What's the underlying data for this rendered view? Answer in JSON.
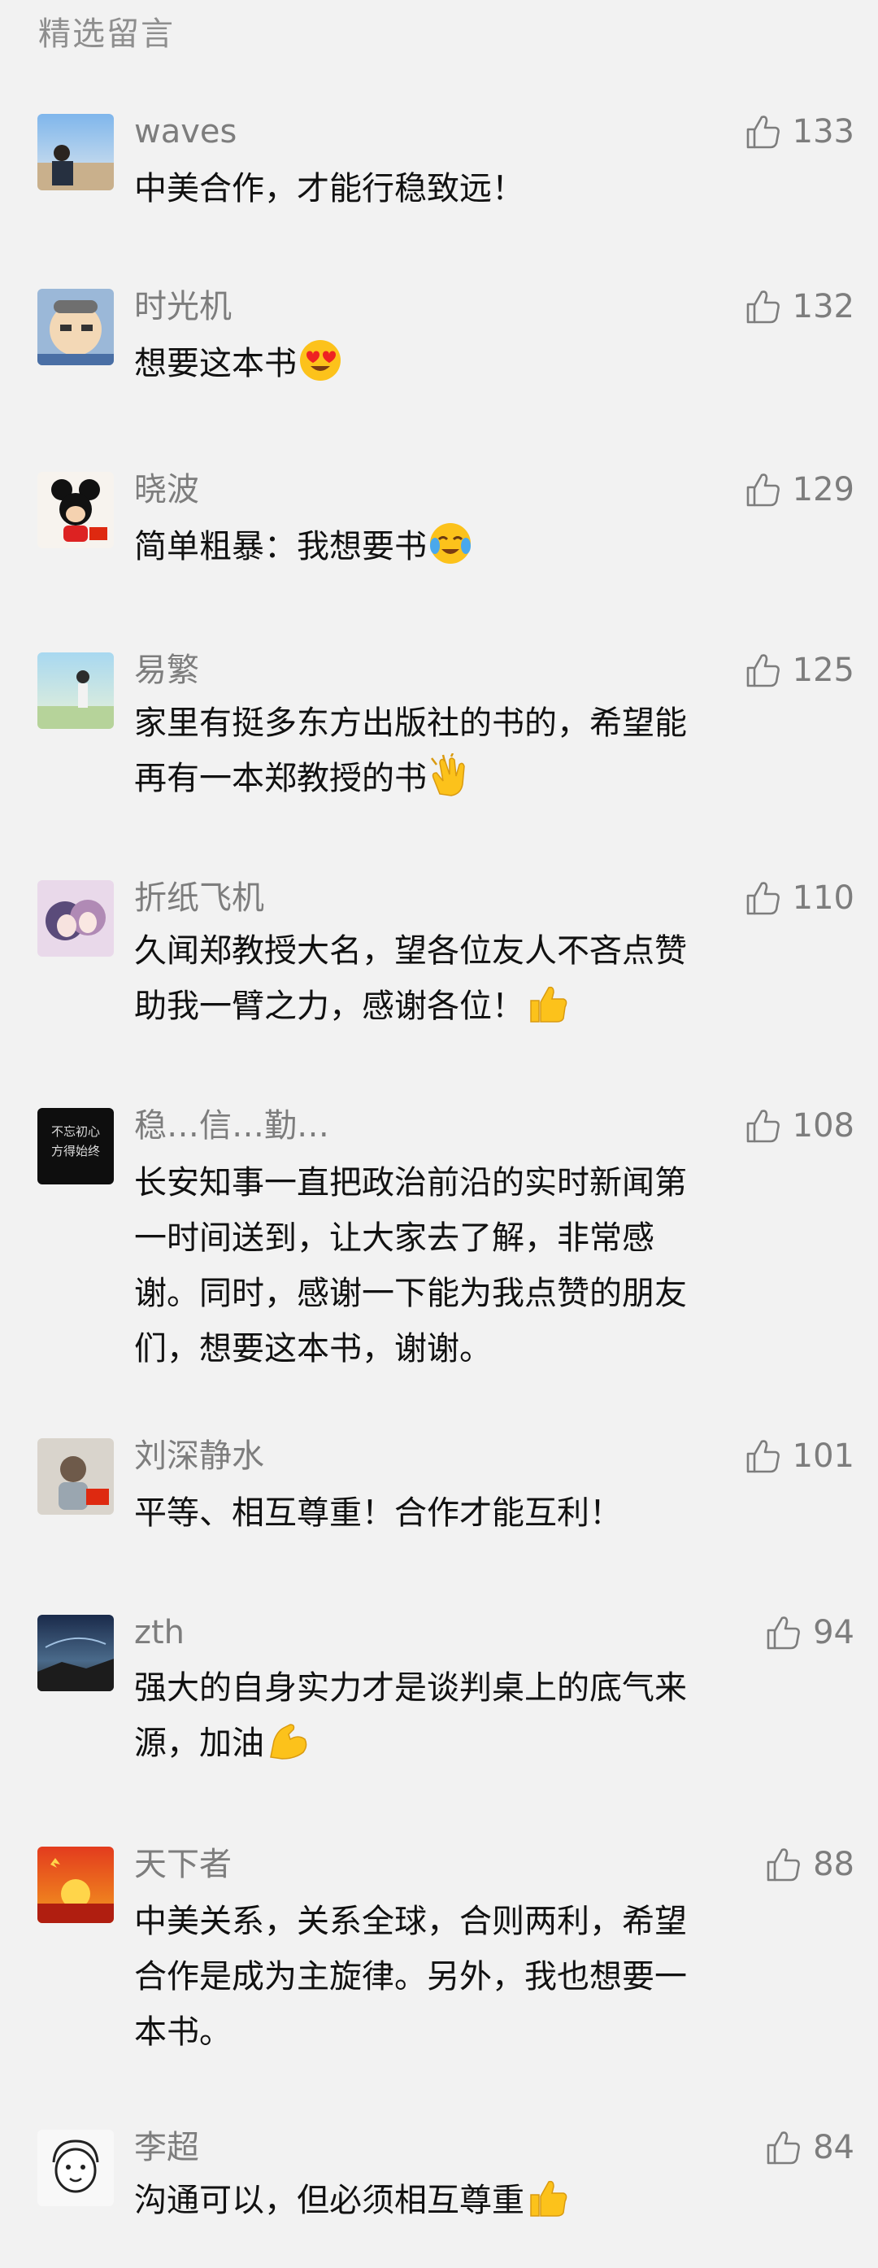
{
  "section_title": "精选留言",
  "comments": [
    {
      "name": "waves",
      "likes": "133",
      "lines": [
        "中美合作，才能行稳致远！"
      ]
    },
    {
      "name": "时光机",
      "likes": "132",
      "lines": [
        "想要这本书"
      ],
      "emoji": "heart-eyes-emoji"
    },
    {
      "name": "晓波",
      "likes": "129",
      "lines": [
        "简单粗暴：我想要书"
      ],
      "emoji": "crying-emoji"
    },
    {
      "name": "易繁",
      "likes": "125",
      "lines": [
        "家里有挺多东方出版社的书的，希望能",
        "再有一本郑教授的书"
      ],
      "emoji": "clapping-emoji"
    },
    {
      "name": "折纸飞机",
      "likes": "110",
      "lines": [
        "久闻郑教授大名，望各位友人不吝点赞",
        "助我一臂之力，感谢各位！"
      ],
      "emoji": "thumbs-up-emoji"
    },
    {
      "name": "稳…信…勤…",
      "likes": "108",
      "lines": [
        "长安知事一直把政治前沿的实时新闻第",
        "一时间送到，让大家去了解，非常感",
        "谢。同时，感谢一下能为我点赞的朋友",
        "们，想要这本书，谢谢。"
      ]
    },
    {
      "name": "刘深静水",
      "likes": "101",
      "lines": [
        "平等、相互尊重！合作才能互利！"
      ]
    },
    {
      "name": "zth",
      "likes": "94",
      "lines": [
        "强大的自身实力才是谈判桌上的底气来",
        "源，加油"
      ],
      "emoji": "flexed-arm-emoji"
    },
    {
      "name": "天下者",
      "likes": "88",
      "lines": [
        "中美关系，关系全球，合则两利，希望",
        "合作是成为主旋律。另外，我也想要一",
        "本书。"
      ]
    },
    {
      "name": "李超",
      "likes": "84",
      "lines": [
        "沟通可以，但必须相互尊重"
      ],
      "emoji": "thumbs-up-emoji"
    }
  ]
}
